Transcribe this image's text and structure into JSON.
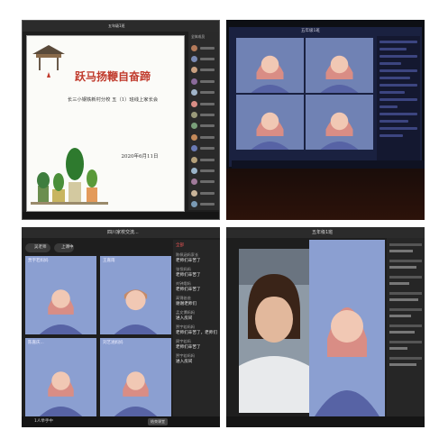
{
  "panel1": {
    "slide_title": "跃马扬鞭自奋蹄",
    "slide_subtitle": "长三小钢铁新村分校 五（1）班线上家长会",
    "slide_date": "2020年6月11日",
    "topbar_title": "五年级1班",
    "sidebar_header": "全体成员"
  },
  "panel2": {
    "screen_title": "五年级1班"
  },
  "panel3": {
    "window_title": "四川家校交流...",
    "me_label": "吴老师",
    "hands_label": "上课中",
    "cells": [
      {
        "label": "贾宇若妈妈"
      },
      {
        "label": "王嘉雨"
      },
      {
        "label": "陈嘉庆..."
      },
      {
        "label": "刘艺涵妈妈"
      }
    ],
    "chat_header": "全部",
    "messages": [
      {
        "who": "陈佩涵妈家长",
        "text": "老师们辛苦了"
      },
      {
        "who": "张恒妈妈",
        "text": "老师们辛苦了"
      },
      {
        "who": "刘钟熠妈",
        "text": "老师们辛苦了"
      },
      {
        "who": "高锦爸爸",
        "text": "谢谢老师们"
      },
      {
        "who": "孟文博妈妈",
        "text": "进入房间"
      },
      {
        "who": "贾宇若妈妈",
        "text": "老师们辛苦了，老师们"
      },
      {
        "who": "周宇若妈",
        "text": "老师们辛苦了"
      },
      {
        "who": "贾宇若妈妈",
        "text": "进入房间"
      }
    ],
    "bottom_label": "1人举手中",
    "end_button": "结束课堂"
  },
  "panel4": {
    "window_title": "五年级1班"
  },
  "colors": {
    "title_red": "#c0392b",
    "placeholder_blue": "#8b9fd1",
    "hair": "#d98d85",
    "body_blue": "#5763a5"
  }
}
